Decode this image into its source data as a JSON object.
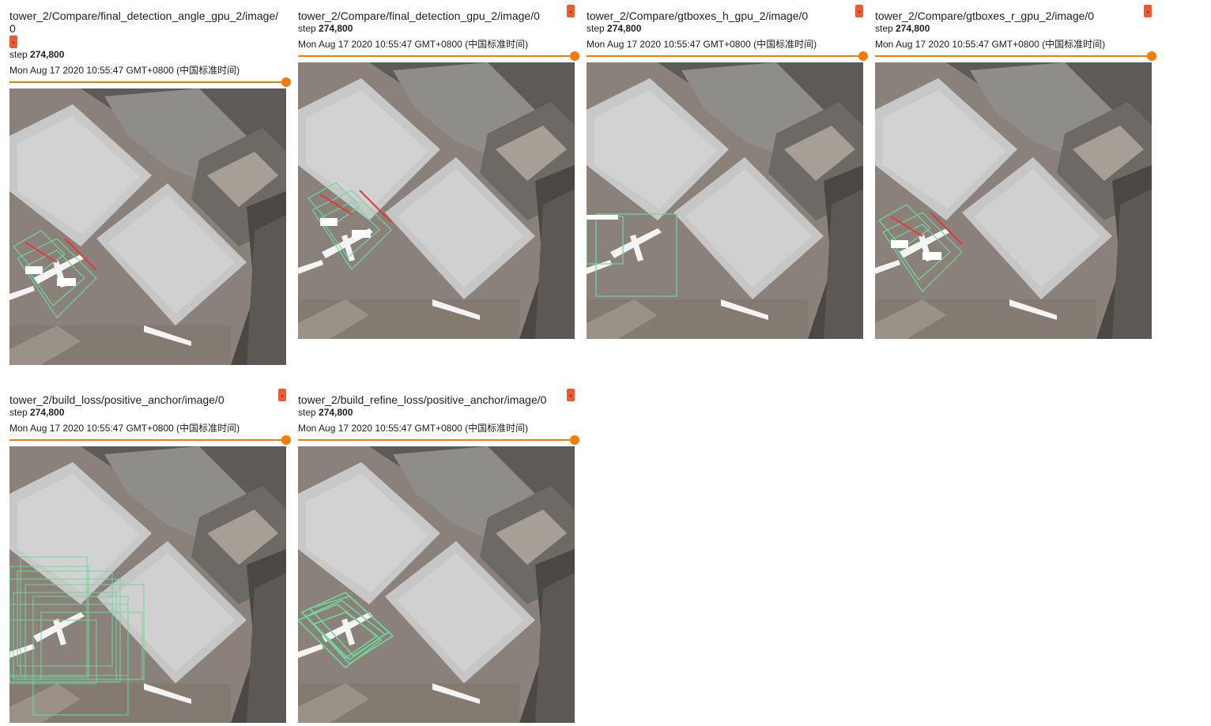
{
  "cards": [
    {
      "title": "tower_2/Compare/final_detection_angle_gpu_2/image/0",
      "step_label": "step",
      "step_value": "274,800",
      "time": "Mon Aug 17 2020 10:55:47 GMT+0800 (中国标准时间)",
      "overlay": "final-detection-angle"
    },
    {
      "title": "tower_2/Compare/final_detection_gpu_2/image/0",
      "step_label": "step",
      "step_value": "274,800",
      "time": "Mon Aug 17 2020 10:55:47 GMT+0800 (中国标准时间)",
      "overlay": "final-detection"
    },
    {
      "title": "tower_2/Compare/gtboxes_h_gpu_2/image/0",
      "step_label": "step",
      "step_value": "274,800",
      "time": "Mon Aug 17 2020 10:55:47 GMT+0800 (中国标准时间)",
      "overlay": "gtboxes-h"
    },
    {
      "title": "tower_2/Compare/gtboxes_r_gpu_2/image/0",
      "step_label": "step",
      "step_value": "274,800",
      "time": "Mon Aug 17 2020 10:55:47 GMT+0800 (中国标准时间)",
      "overlay": "gtboxes-r"
    },
    {
      "title": "tower_2/build_loss/positive_anchor/image/0",
      "step_label": "step",
      "step_value": "274,800",
      "time": "Mon Aug 17 2020 10:55:47 GMT+0800 (中国标准时间)",
      "overlay": "positive-anchor"
    },
    {
      "title": "tower_2/build_refine_loss/positive_anchor/image/0",
      "step_label": "step",
      "step_value": "274,800",
      "time": "Mon Aug 17 2020 10:55:47 GMT+0800 (中国标准时间)",
      "overlay": "refine-positive-anchor"
    }
  ],
  "colors": {
    "accent": "#f57c00",
    "expand_button": "#f2582e",
    "box_green": "#6fd79a",
    "box_red": "#e53935"
  },
  "slider_position": 1.0,
  "icons": {
    "expand": "expand-image-icon"
  }
}
